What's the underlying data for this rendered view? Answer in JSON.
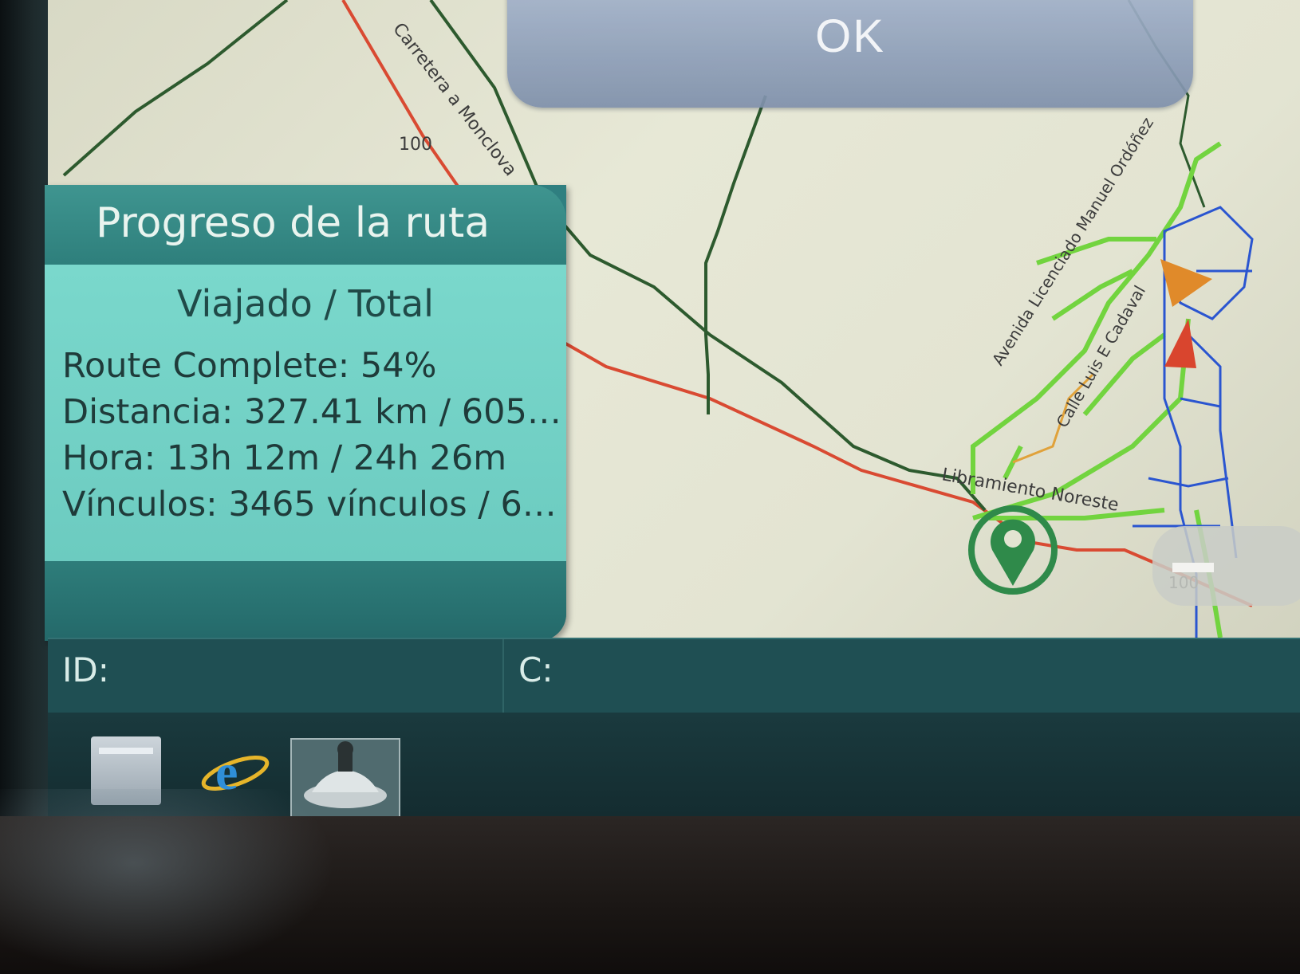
{
  "dialog": {
    "ok_label": "OK"
  },
  "route_panel": {
    "title": "Progreso de la ruta",
    "column_header": "Viajado / Total",
    "route_complete": "Route Complete: 54%",
    "distance": "Distancia: 327.41 km / 605…",
    "time": "Hora: 13h 12m / 24h 26m",
    "links": "Vínculos: 3465 vínculos / 6…"
  },
  "status_bar": {
    "id_label": "ID:",
    "c_label": "C:"
  },
  "map": {
    "roads": {
      "carretera": "Carretera a Monclova",
      "avenida": "Avenida Licenciado Manuel Ordóñez",
      "calle": "Calle Luis E Cadaval",
      "libramiento": "Libramiento Noreste"
    },
    "shield_top": "100",
    "shield_bottom": "100",
    "zoom_out_icon": "minus-icon",
    "location_icon": "map-pin-icon"
  },
  "taskbar": {
    "items": [
      "file-explorer-icon",
      "internet-explorer-icon",
      "car-app-icon"
    ]
  },
  "colors": {
    "route_red": "#d94a32",
    "road_dark_green": "#2d5a2e",
    "road_light_green": "#72d43f",
    "road_blue": "#2a55d0",
    "panel_teal": "#2f7f80",
    "panel_body": "#7ad8cc"
  }
}
